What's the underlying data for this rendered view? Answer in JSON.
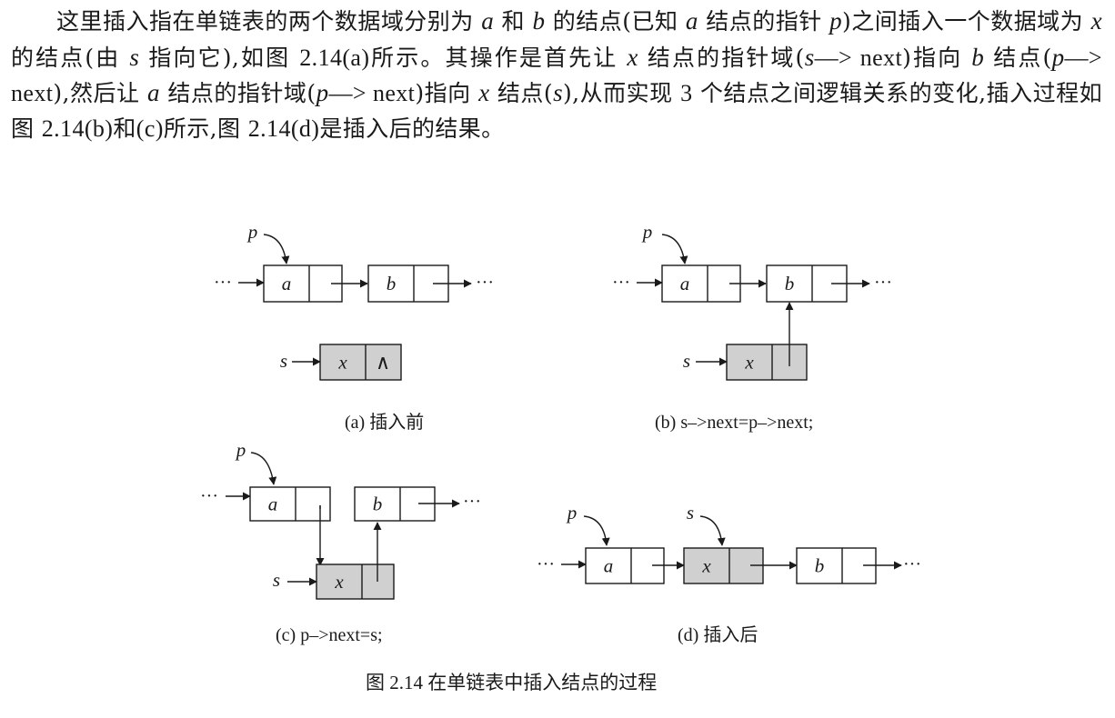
{
  "paragraph": [
    {
      "t": "这里插入指在单链表的两个数据域分别为 "
    },
    {
      "v": "a"
    },
    {
      "t": " 和 "
    },
    {
      "v": "b"
    },
    {
      "t": " 的结点(已知 "
    },
    {
      "v": "a"
    },
    {
      "t": " 结点的指针 "
    },
    {
      "v": "p"
    },
    {
      "t": ")之间插入一个数据域为 "
    },
    {
      "v": "x"
    },
    {
      "t": " 的结点(由 "
    },
    {
      "v": "s"
    },
    {
      "t": " 指向它),如图 "
    },
    {
      "n": "2.14(a)"
    },
    {
      "t": "所示。其操作是首先让 "
    },
    {
      "v": "x"
    },
    {
      "t": " 结点的指针域("
    },
    {
      "v": "s"
    },
    {
      "n": "—> next"
    },
    {
      "t": ")指向 "
    },
    {
      "v": "b"
    },
    {
      "t": " 结点("
    },
    {
      "v": "p"
    },
    {
      "n": "—> next"
    },
    {
      "t": "),然后让 "
    },
    {
      "v": "a"
    },
    {
      "t": " 结点的指针域("
    },
    {
      "v": "p"
    },
    {
      "n": "—> next"
    },
    {
      "t": ")指向 "
    },
    {
      "v": "x"
    },
    {
      "t": " 结点("
    },
    {
      "v": "s"
    },
    {
      "t": "),从而实现 "
    },
    {
      "n": "3"
    },
    {
      "t": " 个结点之间逻辑关系的变化,插入过程如图 "
    },
    {
      "n": "2.14(b)"
    },
    {
      "t": "和"
    },
    {
      "n": "(c)"
    },
    {
      "t": "所示,图 "
    },
    {
      "n": "2.14(d)"
    },
    {
      "t": "是插入后的结果。"
    }
  ],
  "labels": {
    "p": "p",
    "s": "s",
    "a": "a",
    "b": "b",
    "x": "x",
    "ellipsis": "···",
    "null_symbol": "∧"
  },
  "captions": {
    "a": "(a) 插入前",
    "b": "(b) s–>next=p–>next;",
    "c": "(c) p–>next=s;",
    "d": "(d) 插入后"
  },
  "figure_caption": "图 2.14    在单链表中插入结点的过程",
  "colors": {
    "new_node_fill": "#d0d0d0",
    "node_fill": "#ffffff",
    "line": "#1a1a1a"
  }
}
